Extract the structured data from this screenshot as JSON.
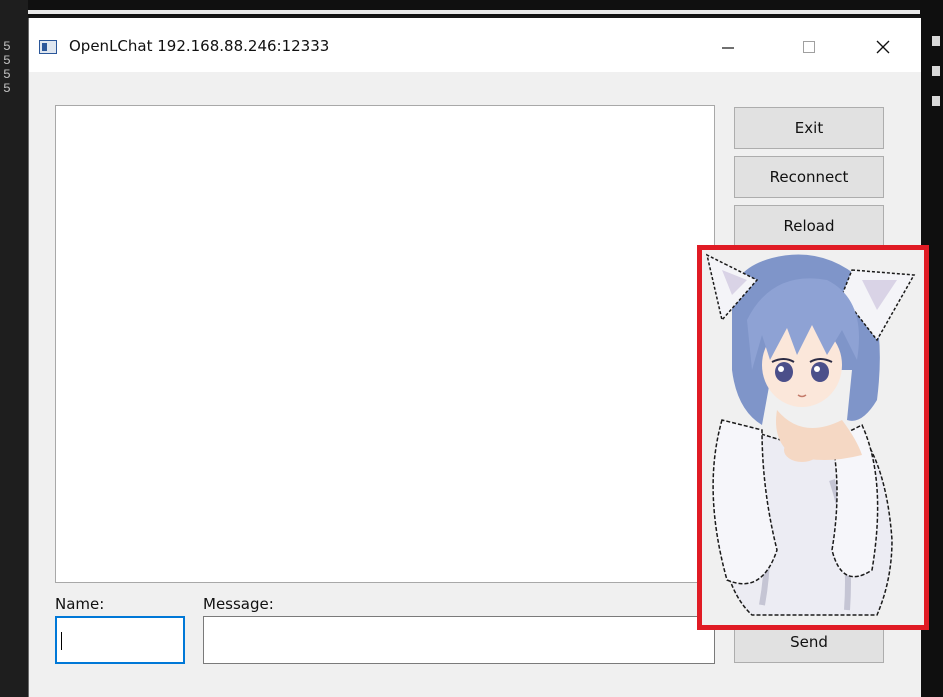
{
  "window": {
    "title": "OpenLChat 192.168.88.246:12333",
    "controls": [
      "minimize-icon",
      "maximize-icon",
      "close-icon"
    ]
  },
  "buttons": {
    "exit": "Exit",
    "reconnect": "Reconnect",
    "reload": "Reload",
    "send": "Send"
  },
  "form": {
    "name_label": "Name:",
    "message_label": "Message:",
    "name_value": "",
    "message_value": ""
  },
  "chat_log": {
    "messages": []
  },
  "background": {
    "left_edge_text": "5\n5\n5\n5"
  },
  "overlay": {
    "image": "anime-cat-girl-mascot",
    "highlight_color": "#e01b24"
  },
  "colors": {
    "focus_border": "#0078d7",
    "window_bg": "#f0f0f0",
    "button_bg": "#e1e1e1"
  }
}
